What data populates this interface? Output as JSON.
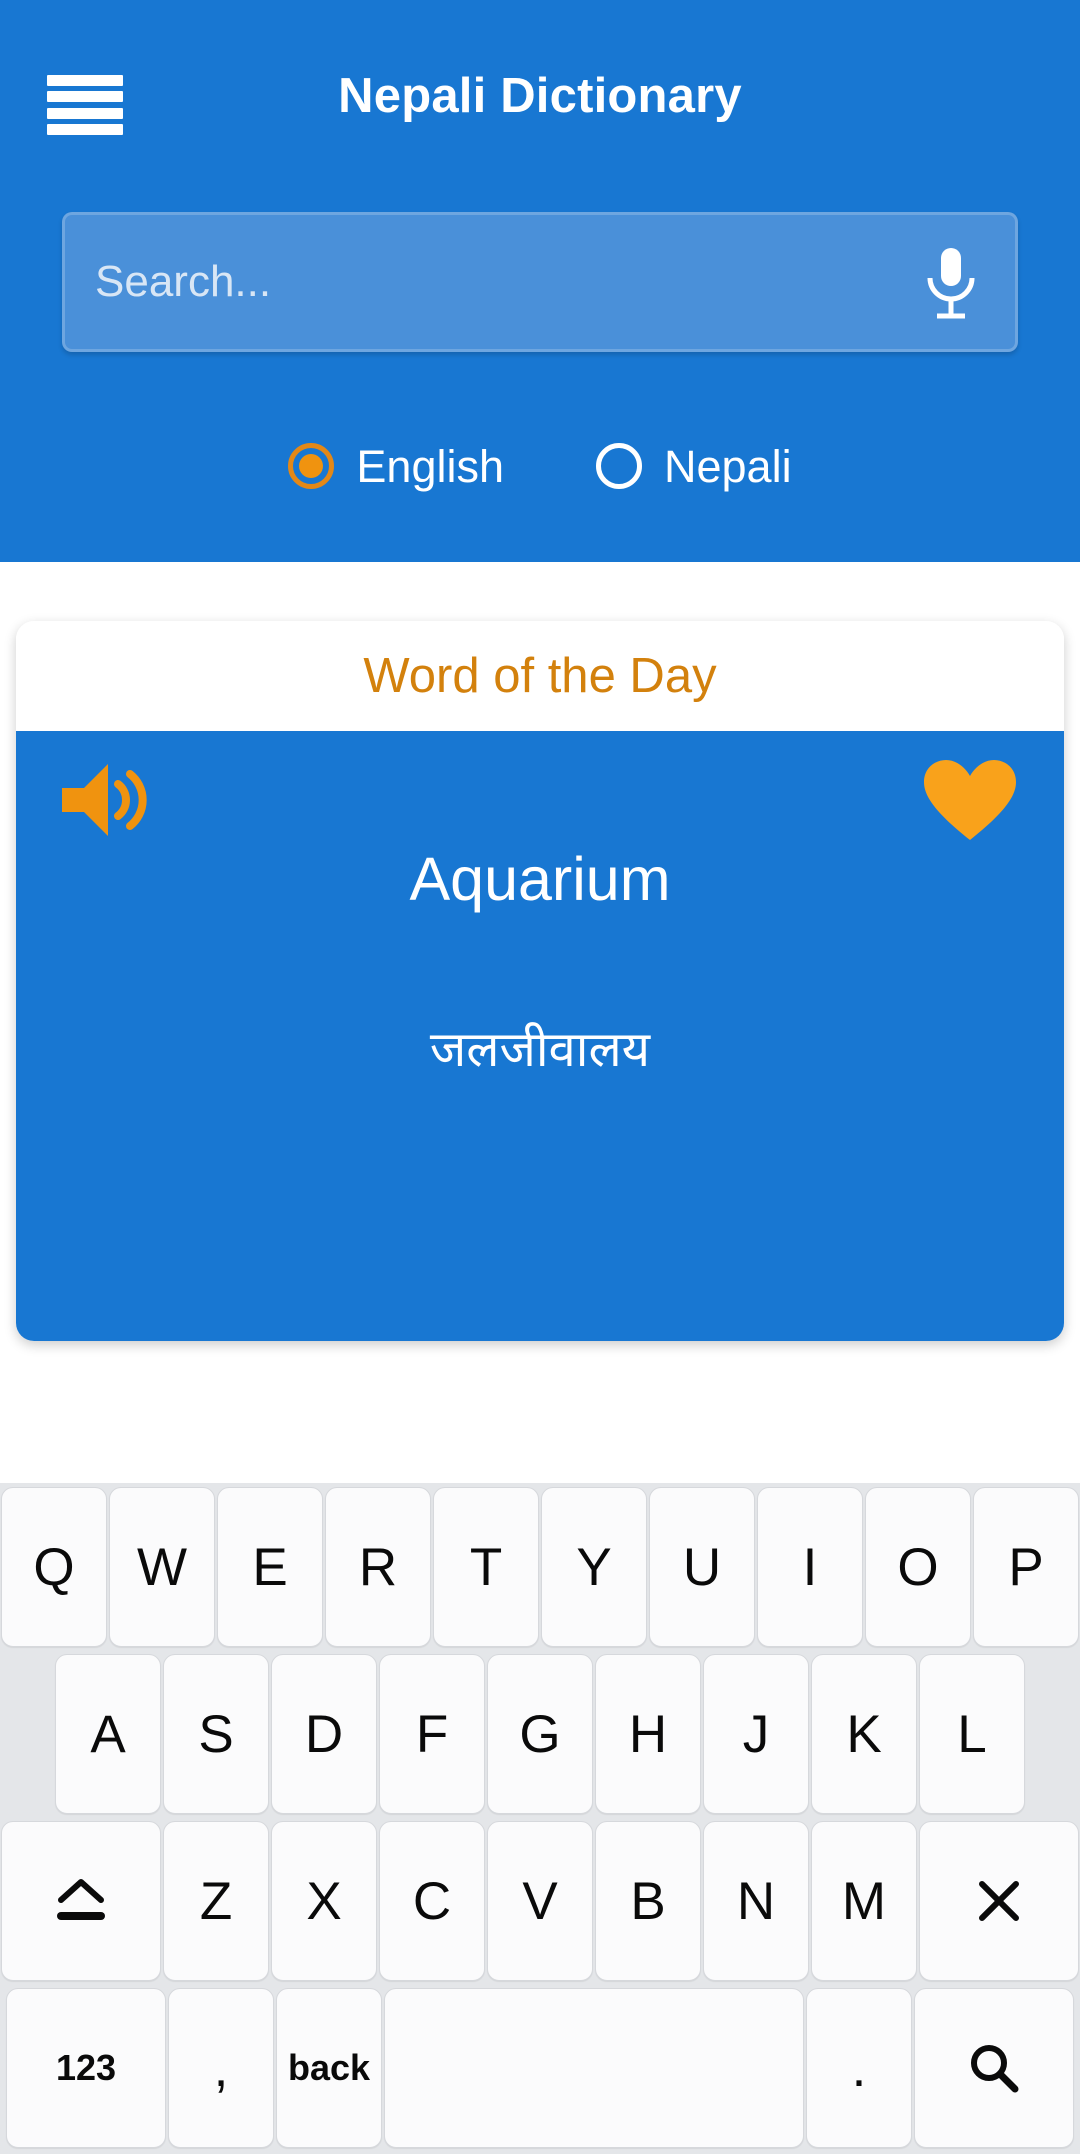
{
  "colors": {
    "primary_blue": "#1877d2",
    "search_field_blue": "#4a90d9",
    "accent_orange": "#f0930f",
    "wotd_title_orange": "#d3810d",
    "keyboard_bg": "#e4e6e9",
    "key_bg": "#fbfbfc"
  },
  "header": {
    "menu_icon": "hamburger-menu-icon",
    "title": "Nepali Dictionary"
  },
  "search": {
    "placeholder": "Search...",
    "value": "",
    "mic_icon": "microphone-icon"
  },
  "language_toggle": {
    "options": [
      {
        "label": "English",
        "selected": true
      },
      {
        "label": "Nepali",
        "selected": false
      }
    ]
  },
  "word_of_the_day": {
    "title": "Word of the Day",
    "speaker_icon": "speaker-volume-icon",
    "favorite_icon": "heart-icon",
    "word": "Aquarium",
    "translation": "जलजीवालय"
  },
  "keyboard": {
    "rows": [
      {
        "keys": [
          {
            "label": "Q"
          },
          {
            "label": "W"
          },
          {
            "label": "E"
          },
          {
            "label": "R"
          },
          {
            "label": "T"
          },
          {
            "label": "Y"
          },
          {
            "label": "U"
          },
          {
            "label": "I"
          },
          {
            "label": "O"
          },
          {
            "label": "P"
          }
        ]
      },
      {
        "keys": [
          {
            "label": "A"
          },
          {
            "label": "S"
          },
          {
            "label": "D"
          },
          {
            "label": "F"
          },
          {
            "label": "G"
          },
          {
            "label": "H"
          },
          {
            "label": "J"
          },
          {
            "label": "K"
          },
          {
            "label": "L"
          }
        ]
      },
      {
        "keys": [
          {
            "label": "⌃",
            "name": "shift-key"
          },
          {
            "label": "Z"
          },
          {
            "label": "X"
          },
          {
            "label": "C"
          },
          {
            "label": "V"
          },
          {
            "label": "B"
          },
          {
            "label": "N"
          },
          {
            "label": "M"
          },
          {
            "label": "✕",
            "name": "backspace-key"
          }
        ]
      },
      {
        "keys": [
          {
            "label": "123",
            "name": "numeric-key"
          },
          {
            "label": ",",
            "name": "comma-key"
          },
          {
            "label": "back",
            "name": "back-key"
          },
          {
            "label": "",
            "name": "space-key"
          },
          {
            "label": ".",
            "name": "period-key"
          },
          {
            "label": "",
            "name": "search-key"
          }
        ]
      }
    ]
  }
}
